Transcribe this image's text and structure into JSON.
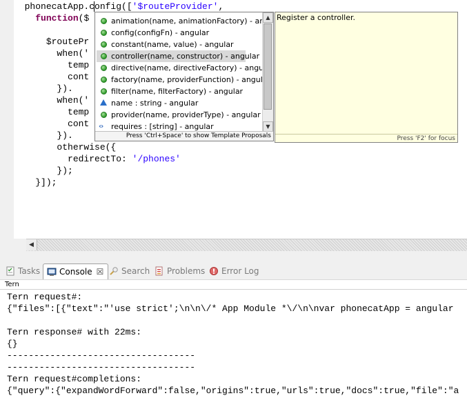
{
  "editor": {
    "code_lines": [
      {
        "indent": "  ",
        "parts": [
          {
            "t": "phonecatApp.config([",
            "c": ""
          },
          {
            "t": "'$routeProvider'",
            "c": "str"
          },
          {
            "t": ",",
            "c": ""
          }
        ]
      },
      {
        "indent": "    ",
        "parts": [
          {
            "t": "function",
            "c": "kw"
          },
          {
            "t": "($",
            "c": ""
          }
        ]
      },
      {
        "indent": "",
        "parts": []
      },
      {
        "indent": "      ",
        "parts": [
          {
            "t": "$routePr",
            "c": ""
          }
        ]
      },
      {
        "indent": "        ",
        "parts": [
          {
            "t": "when('",
            "c": ""
          }
        ]
      },
      {
        "indent": "          ",
        "parts": [
          {
            "t": "temp",
            "c": ""
          }
        ]
      },
      {
        "indent": "          ",
        "parts": [
          {
            "t": "cont",
            "c": ""
          }
        ]
      },
      {
        "indent": "        ",
        "parts": [
          {
            "t": "}).",
            "c": ""
          }
        ]
      },
      {
        "indent": "        ",
        "parts": [
          {
            "t": "when('",
            "c": ""
          }
        ]
      },
      {
        "indent": "          ",
        "parts": [
          {
            "t": "temp",
            "c": ""
          }
        ]
      },
      {
        "indent": "          ",
        "parts": [
          {
            "t": "cont",
            "c": ""
          }
        ]
      },
      {
        "indent": "        ",
        "parts": [
          {
            "t": "}).",
            "c": ""
          }
        ]
      },
      {
        "indent": "        ",
        "parts": [
          {
            "t": "otherwise({",
            "c": ""
          }
        ]
      },
      {
        "indent": "          ",
        "parts": [
          {
            "t": "redirectTo: ",
            "c": ""
          },
          {
            "t": "'/phones'",
            "c": "str"
          }
        ]
      },
      {
        "indent": "        ",
        "parts": [
          {
            "t": "});",
            "c": ""
          }
        ]
      },
      {
        "indent": "    ",
        "parts": [
          {
            "t": "}]);",
            "c": ""
          }
        ]
      }
    ]
  },
  "content_assist": {
    "proposals": [
      {
        "label": "animation(name, animationFactory) - angular",
        "icon": "function-dot-icon",
        "selected": false
      },
      {
        "label": "config(configFn) - angular",
        "icon": "function-dot-icon",
        "selected": false
      },
      {
        "label": "constant(name, value) - angular",
        "icon": "function-dot-icon",
        "selected": false
      },
      {
        "label": "controller(name, constructor) - angular",
        "icon": "function-dot-icon",
        "selected": true
      },
      {
        "label": "directive(name, directiveFactory) - angular",
        "icon": "function-dot-icon",
        "selected": false
      },
      {
        "label": "factory(name, providerFunction) - angular",
        "icon": "function-dot-icon",
        "selected": false
      },
      {
        "label": "filter(name, filterFactory) - angular",
        "icon": "function-dot-icon",
        "selected": false
      },
      {
        "label": "name : string - angular",
        "icon": "property-triangle-icon",
        "selected": false
      },
      {
        "label": "provider(name, providerType) - angular",
        "icon": "function-dot-icon",
        "selected": false
      },
      {
        "label": "requires : [string] - angular",
        "icon": "array-brackets-icon",
        "selected": false
      }
    ],
    "status": "Press 'Ctrl+Space' to show Template Proposals"
  },
  "doc_hover": {
    "text": "Register a controller.",
    "status": "Press 'F2' for focus"
  },
  "views": {
    "tabs": [
      {
        "label": "Tasks",
        "icon": "tasks-icon",
        "active": false
      },
      {
        "label": "Console",
        "icon": "console-icon",
        "active": true
      },
      {
        "label": "Search",
        "icon": "search-icon",
        "active": false
      },
      {
        "label": "Problems",
        "icon": "problems-icon",
        "active": false
      },
      {
        "label": "Error Log",
        "icon": "error-log-icon",
        "active": false
      }
    ],
    "console_title": "Tern",
    "console_lines": [
      "Tern request#:",
      "{\"files\":[{\"text\":\"'use strict';\\n\\n\\/* App Module *\\/\\n\\nvar phonecatApp = angular",
      "",
      "Tern response# with 22ms:",
      "{}",
      "-----------------------------------",
      "-----------------------------------",
      "Tern request#completions:",
      "{\"query\":{\"expandWordForward\":false,\"origins\":true,\"urls\":true,\"docs\":true,\"file\":\"a"
    ]
  },
  "colors": {
    "keyword": "#7f0055",
    "string": "#2a00ff",
    "doc_background": "#ffffe1",
    "selection": "#d9d9d9"
  }
}
